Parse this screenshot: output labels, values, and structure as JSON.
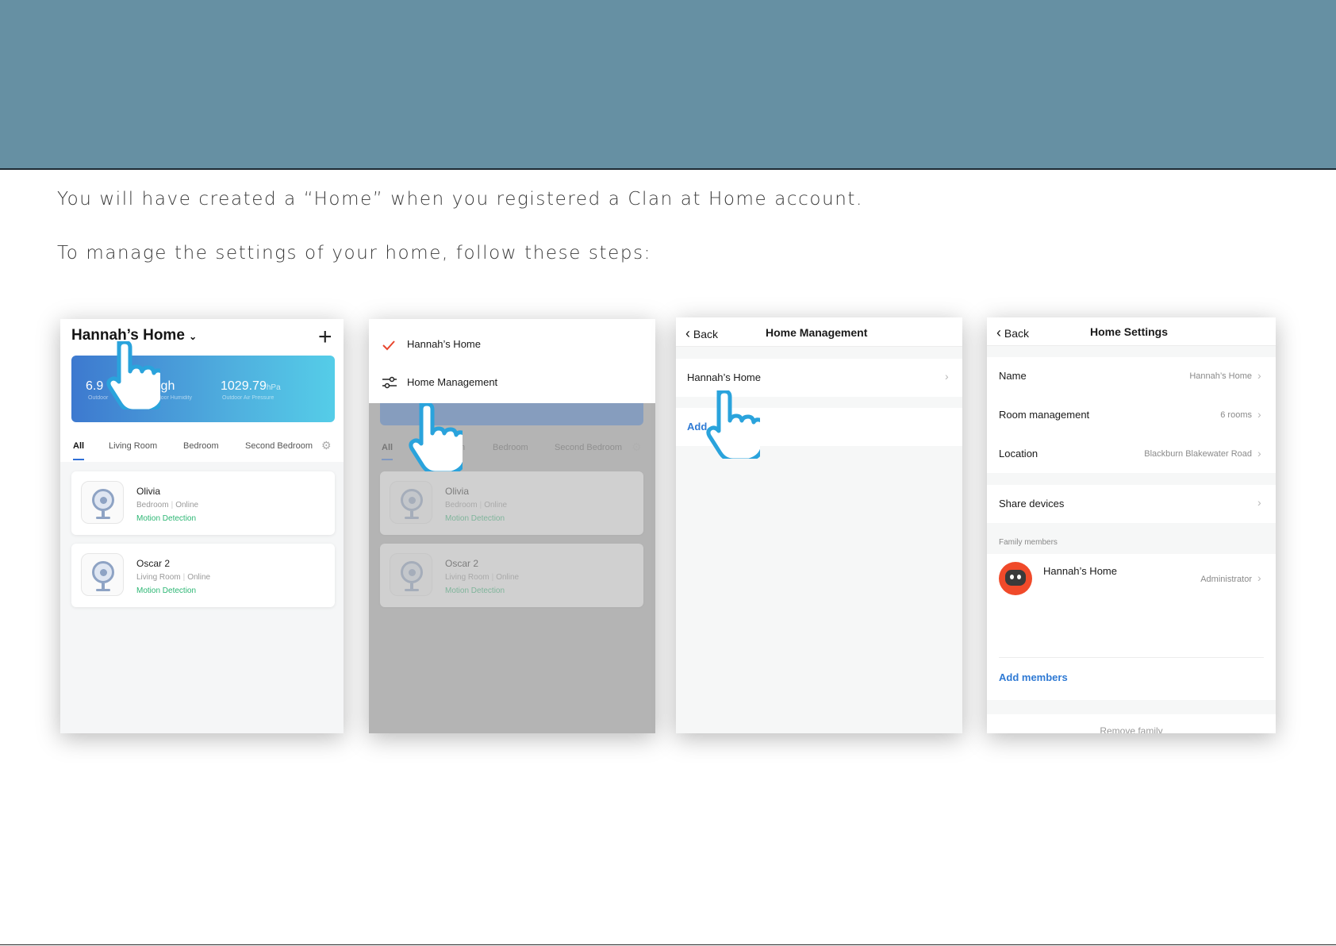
{
  "intro": {
    "line1": "You will have created a “Home” when you registered a Clan at Home account.",
    "line2": "To manage the settings of your home, follow these steps:"
  },
  "colors": {
    "banner": "#6690a3",
    "accent": "#2f7ad4",
    "online_green": "#2bb673",
    "check_red": "#e8462e"
  },
  "screen1": {
    "home_title": "Hannah’s Home",
    "add_icon": "plus-icon",
    "weather": {
      "temp_value": "6.9",
      "humidity_value": "igh",
      "pressure_value": "1029.79",
      "pressure_unit": "hPa",
      "temp_label": "Outdoor",
      "humidity_label": "utdoor Humidity",
      "pressure_label": "Outdoor Air Pressure"
    },
    "tabs": [
      "All",
      "Living Room",
      "Bedroom",
      "Second Bedroom"
    ],
    "devices": [
      {
        "name": "Olivia",
        "room": "Bedroom",
        "status": "Online",
        "state": "Motion Detection"
      },
      {
        "name": "Oscar 2",
        "room": "Living Room",
        "status": "Online",
        "state": "Motion Detection"
      }
    ]
  },
  "screen2": {
    "menu": [
      {
        "label": "Hannah’s Home",
        "icon": "check-icon"
      },
      {
        "label": "Home Management",
        "icon": "sliders-icon"
      }
    ],
    "tabs": [
      "All",
      "m",
      "Bedroom",
      "Second Bedroom"
    ],
    "devices": [
      {
        "name": "Olivia",
        "room": "Bedroom",
        "status": "Online",
        "state": "Motion Detection"
      },
      {
        "name": "Oscar 2",
        "room": "Living Room",
        "status": "Online",
        "state": "Motion Detection"
      }
    ]
  },
  "screen3": {
    "back": "Back",
    "title": "Home Management",
    "home_row": "Hannah’s Home",
    "add_partial": "Add"
  },
  "screen4": {
    "back": "Back",
    "title": "Home Settings",
    "rows": [
      {
        "label": "Name",
        "value": "Hannah’s Home"
      },
      {
        "label": "Room management",
        "value": "6 rooms"
      },
      {
        "label": "Location",
        "value": "Blackburn Blakewater Road"
      }
    ],
    "share": "Share devices",
    "family_label": "Family members",
    "member": {
      "name": "Hannah’s Home",
      "role": "Administrator"
    },
    "add_members": "Add members",
    "remove": "Remove family"
  }
}
